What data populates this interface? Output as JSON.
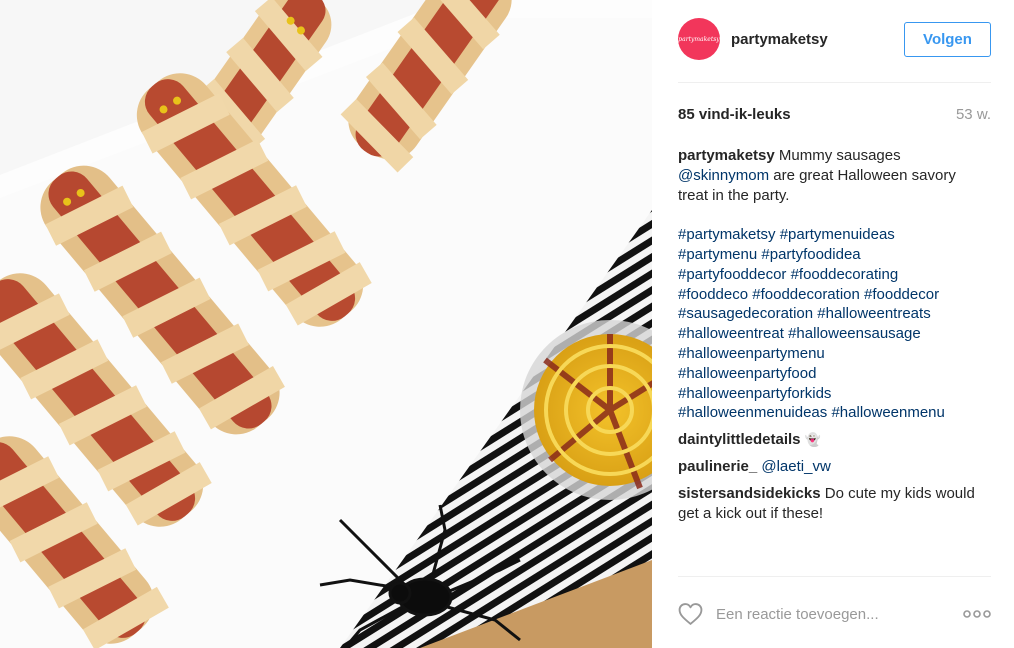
{
  "post": {
    "photo": {
      "alt": "Mummy sausages on a white tray with a bowl of dip and a plastic spider"
    }
  },
  "header": {
    "avatar_text": "partymaketsy",
    "username": "partymaketsy",
    "follow_label": "Volgen"
  },
  "stats": {
    "likes": "85 vind-ik-leuks",
    "age": "53 w."
  },
  "caption": {
    "author": "partymaketsy",
    "line1_text": " Mummy sausages",
    "mention": "@skinnymom",
    "line2_rest": " are great Halloween savory",
    "line3": "treat in the party.",
    "hashtag_lines": [
      [
        "#partymaketsy",
        "#partymenuideas"
      ],
      [
        "#partymenu",
        "#partyfoodidea"
      ],
      [
        "#partyfooddecor",
        "#fooddecorating"
      ],
      [
        "#fooddeco",
        "#fooddecoration",
        "#fooddecor"
      ],
      [
        "#sausagedecoration",
        "#halloweentreats"
      ],
      [
        "#halloweentreat",
        "#halloweensausage"
      ],
      [
        "#halloweenpartymenu"
      ],
      [
        "#halloweenpartyfood"
      ],
      [
        "#halloweenpartyforkids"
      ],
      [
        "#halloweenmenuideas",
        "#halloweenmenu"
      ]
    ]
  },
  "comments": [
    {
      "author": "daintylittledetails",
      "emoji": "👻"
    },
    {
      "author": "paulinerie_",
      "mention": "@laeti_vw"
    },
    {
      "author": "sistersandsidekicks",
      "line1": " Do cute my kids would",
      "line2": "get a kick out if these!"
    }
  ],
  "add_comment": {
    "placeholder": "Een reactie toevoegen...",
    "more_icon": "ellipsis-icon",
    "like_icon": "heart-outline-icon"
  },
  "colors": {
    "link": "#003569",
    "follow": "#3897f0",
    "muted": "#999999",
    "avatar_bg": "#f2365b"
  }
}
